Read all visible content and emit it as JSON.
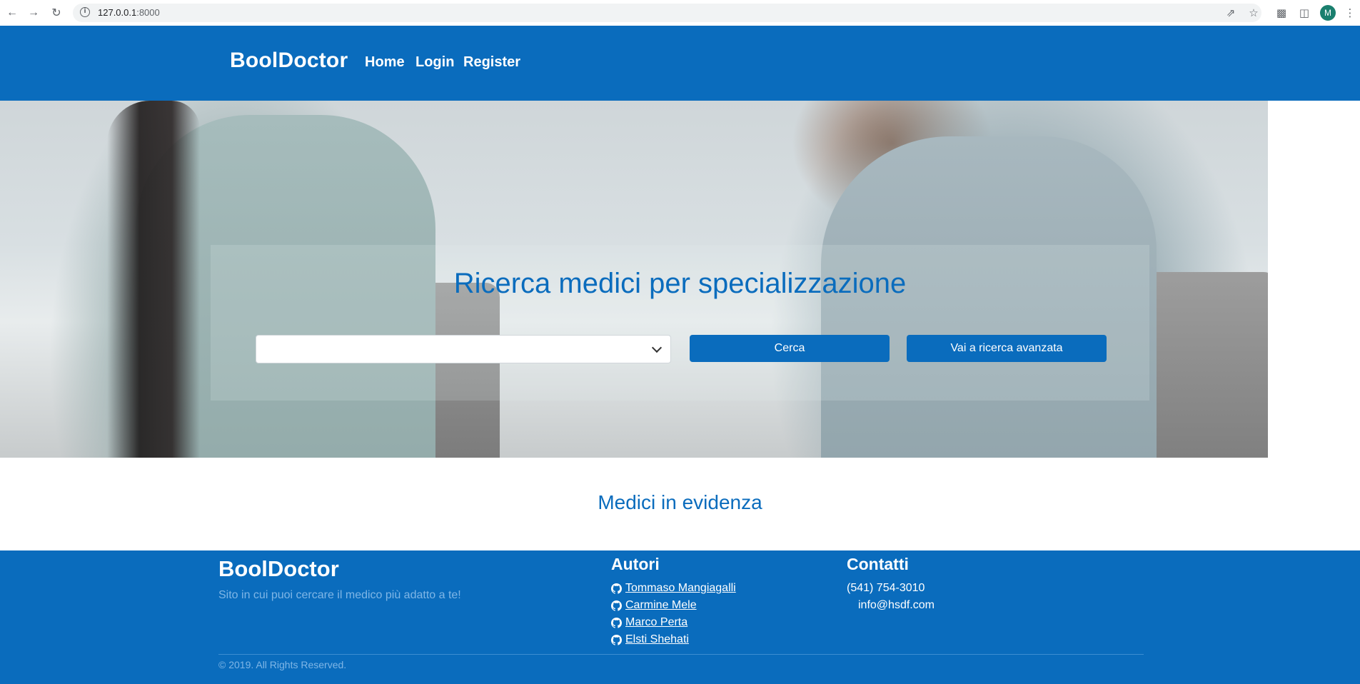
{
  "browser": {
    "url_host": "127.0.0.1",
    "url_port": ":8000",
    "profile_initial": "M"
  },
  "header": {
    "brand": "BoolDoctor",
    "nav": [
      "Home",
      "Login",
      "Register"
    ]
  },
  "hero": {
    "title": "Ricerca medici per specializzazione",
    "select_value": "",
    "search_button": "Cerca",
    "advanced_button": "Vai a ricerca avanzata"
  },
  "featured": {
    "title": "Medici in evidenza"
  },
  "footer": {
    "brand": "BoolDoctor",
    "tagline": "Sito in cui puoi cercare il medico più adatto a te!",
    "authors_title": "Autori",
    "authors": [
      "Tommaso Mangiagalli",
      "Carmine Mele",
      "Marco Perta",
      "Elsti Shehati"
    ],
    "contacts_title": "Contatti",
    "phone": "(541) 754-3010",
    "email": "info@hsdf.com",
    "copyright": "© 2019. All Rights Reserved."
  },
  "colors": {
    "brand_blue": "#0a6cbd",
    "muted_blue": "#7fb6e6"
  }
}
